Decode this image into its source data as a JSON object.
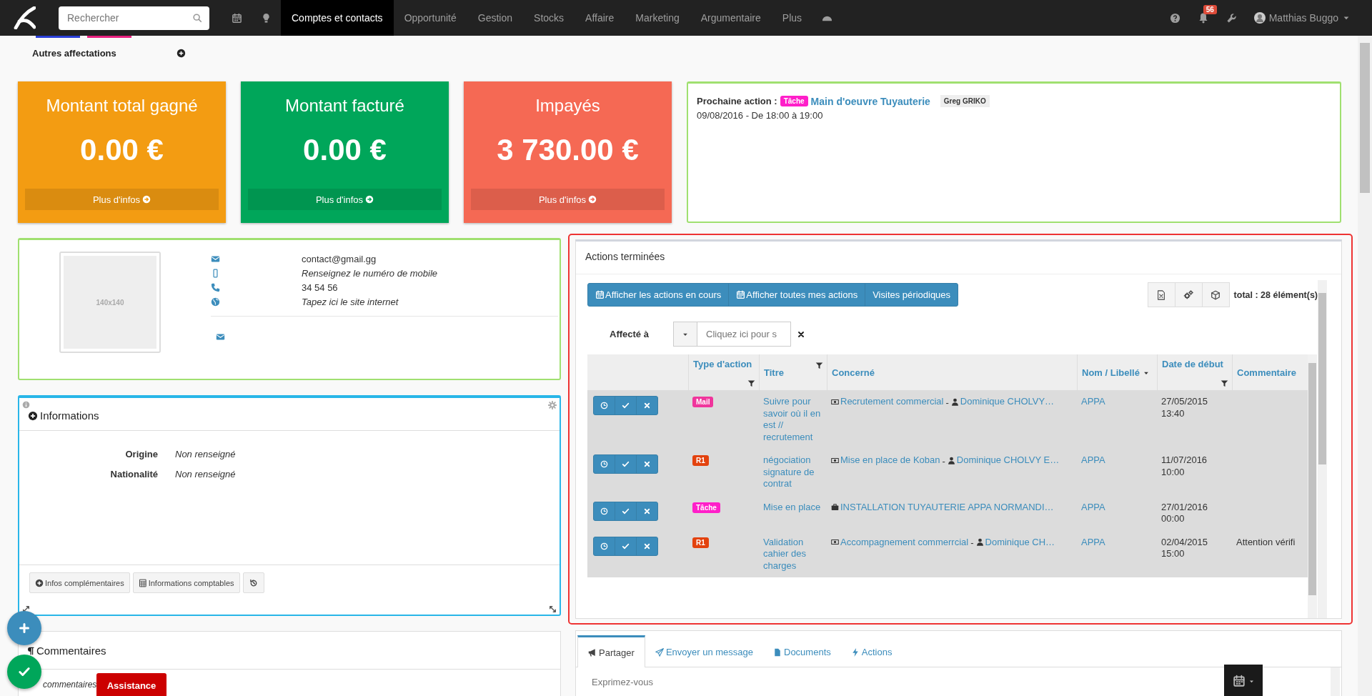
{
  "topbar": {
    "search": {
      "placeholder": "Rechercher"
    },
    "nav": [
      {
        "label": "Comptes et contacts",
        "selected": true
      },
      {
        "label": "Opportunité",
        "selected": false
      },
      {
        "label": "Gestion",
        "selected": false
      },
      {
        "label": "Stocks",
        "selected": false
      },
      {
        "label": "Affaire",
        "selected": false
      },
      {
        "label": "Marketing",
        "selected": false
      },
      {
        "label": "Argumentaire",
        "selected": false
      },
      {
        "label": "Plus",
        "selected": false
      }
    ],
    "notifications": "56",
    "user": "Matthias Buggo"
  },
  "assignments": {
    "label": "Autres affectations"
  },
  "stats": [
    {
      "title": "Montant total gagné",
      "value": "0.00 €",
      "link": "Plus d'infos",
      "color": "#f39c12"
    },
    {
      "title": "Montant facturé",
      "value": "0.00 €",
      "link": "Plus d'infos",
      "color": "#00a65a"
    },
    {
      "title": "Impayés",
      "value": "3 730.00 €",
      "link": "Plus d'infos",
      "color": "#f56954"
    }
  ],
  "next_action": {
    "label": "Prochaine action :",
    "tag": {
      "text": "Tâche",
      "color": "#ff1fc9"
    },
    "title": "Main d'oeuvre Tuyauterie",
    "owner": "Greg GRIKO",
    "when": "09/08/2016 - De 18:00 à 19:00"
  },
  "contact": {
    "photo": "140x140",
    "lines": [
      {
        "kind": "email",
        "text": "contact@gmail.gg",
        "filled": true
      },
      {
        "kind": "mobile",
        "text": "Renseignez le numéro de mobile",
        "filled": false
      },
      {
        "kind": "phone",
        "text": "34 54 56",
        "filled": true
      },
      {
        "kind": "web",
        "text": "Tapez ici le site internet",
        "filled": false
      }
    ]
  },
  "informations": {
    "title": "Informations",
    "fields": [
      {
        "label": "Origine",
        "value": "Non renseigné"
      },
      {
        "label": "Nationalité",
        "value": "Non renseigné"
      }
    ],
    "buttons": [
      "Infos complémentaires",
      "Informations comptables"
    ]
  },
  "actions": {
    "title": "Actions terminées",
    "views": [
      "Afficher les actions en cours",
      "Afficher toutes mes actions",
      "Visites périodiques"
    ],
    "total": "total : 28 élément(s)",
    "filter": {
      "label": "Affecté à",
      "placeholder": "Cliquez ici pour s"
    },
    "columns": [
      {
        "label": "Type d'action",
        "filter": true,
        "sort": false
      },
      {
        "label": "Titre",
        "filter": true,
        "sort": false
      },
      {
        "label": "Concerné",
        "filter": false,
        "sort": false
      },
      {
        "label": "Nom / Libellé",
        "filter": false,
        "sort": true
      },
      {
        "label": "Date de début",
        "filter": true,
        "sort": false
      },
      {
        "label": "Commentaire",
        "filter": false,
        "sort": false
      }
    ],
    "rows": [
      {
        "type": {
          "text": "Mail",
          "color": "#f0359c"
        },
        "title": "Suivre pour savoir où il en est // recrutement",
        "concerned": [
          {
            "kind": "money",
            "text": "Recrutement commercial"
          },
          {
            "kind": "separator",
            "text": "-"
          },
          {
            "kind": "person",
            "text": "Dominique CHOLVY…"
          }
        ],
        "name": "APPA",
        "date": "27/05/2015",
        "time": "13:40"
      },
      {
        "type": {
          "text": "R1",
          "color": "#e3420e"
        },
        "title": "négociation signature de contrat",
        "concerned": [
          {
            "kind": "money",
            "text": "Mise en place de Koban"
          },
          {
            "kind": "separator",
            "text": "-"
          },
          {
            "kind": "person",
            "text": "Dominique CHOLVY E…"
          }
        ],
        "name": "APPA",
        "date": "11/07/2016",
        "time": "10:00"
      },
      {
        "type": {
          "text": "Tâche",
          "color": "#ff1fc9"
        },
        "title": "Mise en place",
        "concerned": [
          {
            "kind": "case",
            "text": "INSTALLATION TUYAUTERIE APPA NORMANDI…"
          }
        ],
        "name": "APPA",
        "date": "27/01/2016",
        "time": "00:00"
      },
      {
        "type": {
          "text": "R1",
          "color": "#e3420e"
        },
        "title": "Validation cahier des charges",
        "concerned": [
          {
            "kind": "money",
            "text": "Accompagnement commerrcial"
          },
          {
            "kind": "separator",
            "text": "-"
          },
          {
            "kind": "person",
            "text": "Dominique CH…"
          }
        ],
        "name": "APPA",
        "date": "02/04/2015",
        "time": "15:00",
        "comment": "Attention vérifi"
      }
    ]
  },
  "comments": {
    "title": "Commentaires",
    "text": "commentaires"
  },
  "assistance": "Assistance",
  "share": {
    "tabs": [
      {
        "label": "Partager",
        "selected": true
      },
      {
        "label": "Envoyer un message",
        "selected": false
      },
      {
        "label": "Documents",
        "selected": false
      },
      {
        "label": "Actions",
        "selected": false
      }
    ],
    "placeholder": "Exprimez-vous"
  }
}
